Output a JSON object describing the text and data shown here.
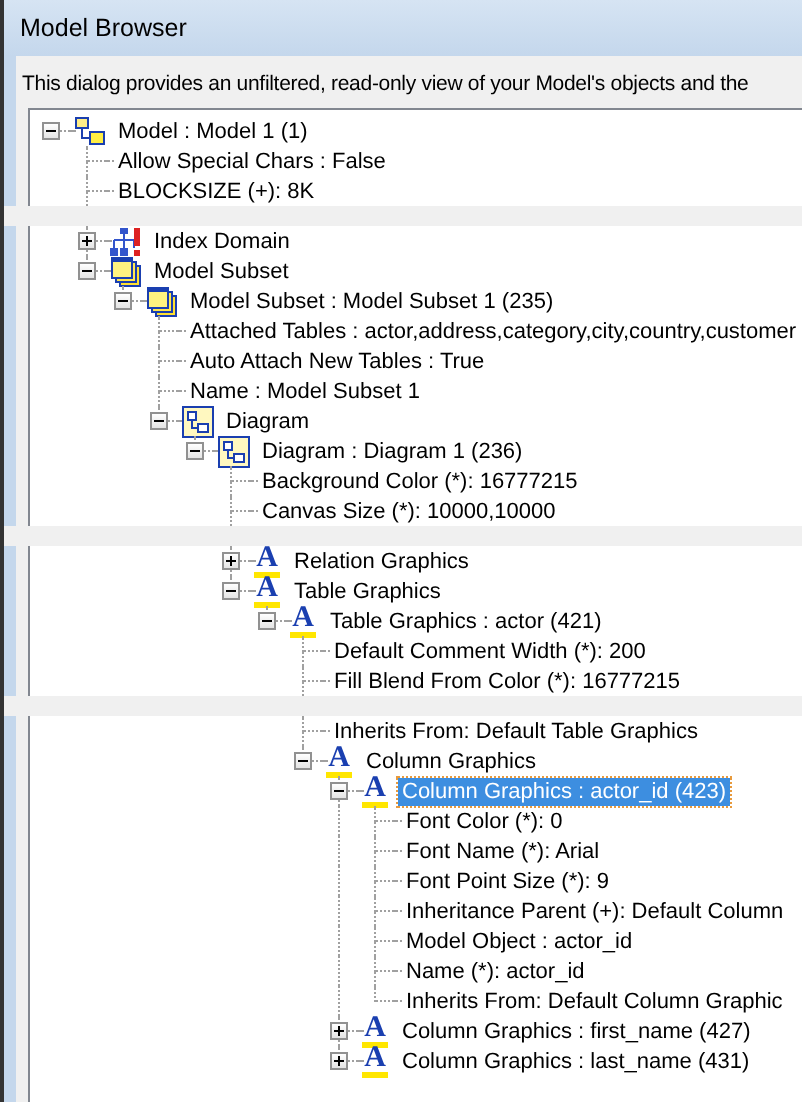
{
  "window": {
    "title": "Model Browser"
  },
  "description": "This dialog provides an unfiltered, read-only view of your Model's objects and the",
  "tree": [
    {
      "kind": "model",
      "label": "Model : Model 1 (1)",
      "expanded": true,
      "selected": false,
      "children": [
        {
          "kind": "property",
          "label": "Allow Special Chars : False",
          "selected": false
        },
        {
          "kind": "property",
          "label": "BLOCKSIZE (+): 8K",
          "selected": false
        },
        {
          "kind": "gap"
        },
        {
          "kind": "index_domain",
          "label": "Index Domain",
          "expanded": false,
          "selected": false
        },
        {
          "kind": "subset",
          "label": "Model Subset",
          "expanded": true,
          "selected": false,
          "children": [
            {
              "kind": "subset",
              "label": "Model Subset : Model Subset 1 (235)",
              "expanded": true,
              "selected": false,
              "children": [
                {
                  "kind": "property",
                  "label": "Attached Tables : actor,address,category,city,country,customer",
                  "selected": false
                },
                {
                  "kind": "property",
                  "label": "Auto Attach New Tables : True",
                  "selected": false
                },
                {
                  "kind": "property",
                  "label": "Name : Model Subset 1",
                  "selected": false
                },
                {
                  "kind": "diagram",
                  "label": "Diagram",
                  "expanded": true,
                  "selected": false,
                  "children": [
                    {
                      "kind": "diagram",
                      "label": "Diagram : Diagram 1 (236)",
                      "expanded": true,
                      "selected": false,
                      "children": [
                        {
                          "kind": "property",
                          "label": "Background Color (*): 16777215",
                          "selected": false
                        },
                        {
                          "kind": "property",
                          "label": "Canvas Size (*): 10000,10000",
                          "selected": false
                        },
                        {
                          "kind": "gap"
                        },
                        {
                          "kind": "graphics",
                          "glyph": "A",
                          "label": "Relation Graphics",
                          "expanded": false,
                          "selected": false
                        },
                        {
                          "kind": "graphics",
                          "glyph": "A",
                          "label": "Table Graphics",
                          "expanded": true,
                          "selected": false,
                          "children": [
                            {
                              "kind": "graphics",
                              "glyph": "A",
                              "label": "Table Graphics : actor (421)",
                              "expanded": true,
                              "selected": false,
                              "children": [
                                {
                                  "kind": "property",
                                  "label": "Default Comment Width (*): 200",
                                  "selected": false
                                },
                                {
                                  "kind": "property",
                                  "label": "Fill Blend From Color (*): 16777215",
                                  "selected": false
                                },
                                {
                                  "kind": "gap"
                                },
                                {
                                  "kind": "property",
                                  "label": "Inherits From: Default Table Graphics",
                                  "selected": false
                                },
                                {
                                  "kind": "graphics",
                                  "glyph": "A",
                                  "label": "Column Graphics",
                                  "expanded": true,
                                  "selected": false,
                                  "children": [
                                    {
                                      "kind": "graphics",
                                      "glyph": "A",
                                      "label": "Column Graphics : actor_id (423)",
                                      "expanded": true,
                                      "selected": true,
                                      "children": [
                                        {
                                          "kind": "property",
                                          "label": "Font Color (*): 0",
                                          "selected": false
                                        },
                                        {
                                          "kind": "property",
                                          "label": "Font Name (*): Arial",
                                          "selected": false
                                        },
                                        {
                                          "kind": "property",
                                          "label": "Font Point Size (*): 9",
                                          "selected": false
                                        },
                                        {
                                          "kind": "property",
                                          "label": "Inheritance Parent (+): Default Column",
                                          "selected": false
                                        },
                                        {
                                          "kind": "property",
                                          "label": "Model Object : actor_id",
                                          "selected": false
                                        },
                                        {
                                          "kind": "property",
                                          "label": "Name (*): actor_id",
                                          "selected": false
                                        },
                                        {
                                          "kind": "property",
                                          "label": "Inherits From: Default Column Graphic",
                                          "selected": false
                                        }
                                      ]
                                    },
                                    {
                                      "kind": "graphics",
                                      "glyph": "A",
                                      "label": "Column Graphics : first_name (427)",
                                      "expanded": false,
                                      "selected": false
                                    },
                                    {
                                      "kind": "graphics",
                                      "glyph": "A",
                                      "label": "Column Graphics : last_name (431)",
                                      "expanded": false,
                                      "selected": false
                                    }
                                  ]
                                }
                              ]
                            }
                          ]
                        }
                      ]
                    }
                  ]
                }
              ]
            }
          ]
        }
      ]
    }
  ]
}
